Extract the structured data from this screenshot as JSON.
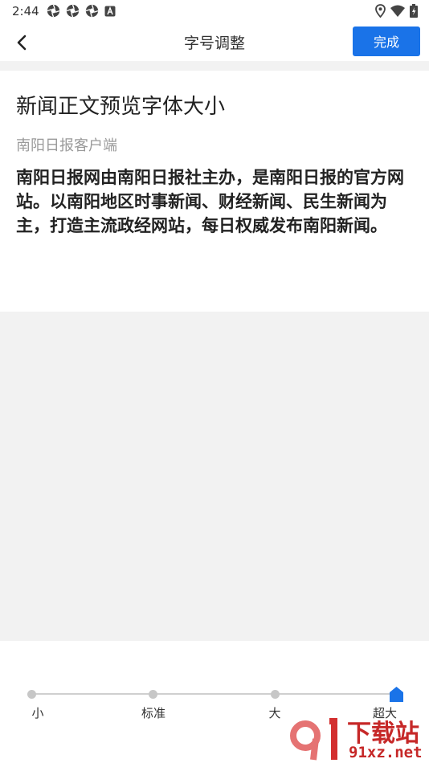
{
  "status_bar": {
    "time": "2:44",
    "left_icons": [
      "aperture-icon",
      "aperture-icon",
      "aperture-icon",
      "font-a-icon"
    ],
    "right_icons": [
      "location-pin-icon",
      "wifi-icon",
      "battery-charging-icon"
    ]
  },
  "header": {
    "back_icon": "chevron-left-icon",
    "title": "字号调整",
    "done_label": "完成",
    "accent_color": "#1a73e8"
  },
  "preview": {
    "title": "新闻正文预览字体大小",
    "source": "南阳日报客户端",
    "body": "南阳日报网由南阳日报社主办，是南阳日报的官方网站。以南阳地区时事新闻、财经新闻、民生新闻为主，打造主流政经网站，每日权威发布南阳新闻。"
  },
  "font_size_slider": {
    "options": [
      "小",
      "标准",
      "大",
      "超大"
    ],
    "selected": "超大",
    "selected_index": 3
  },
  "watermark": {
    "brand": "下载站",
    "domain": "91xz.net"
  }
}
